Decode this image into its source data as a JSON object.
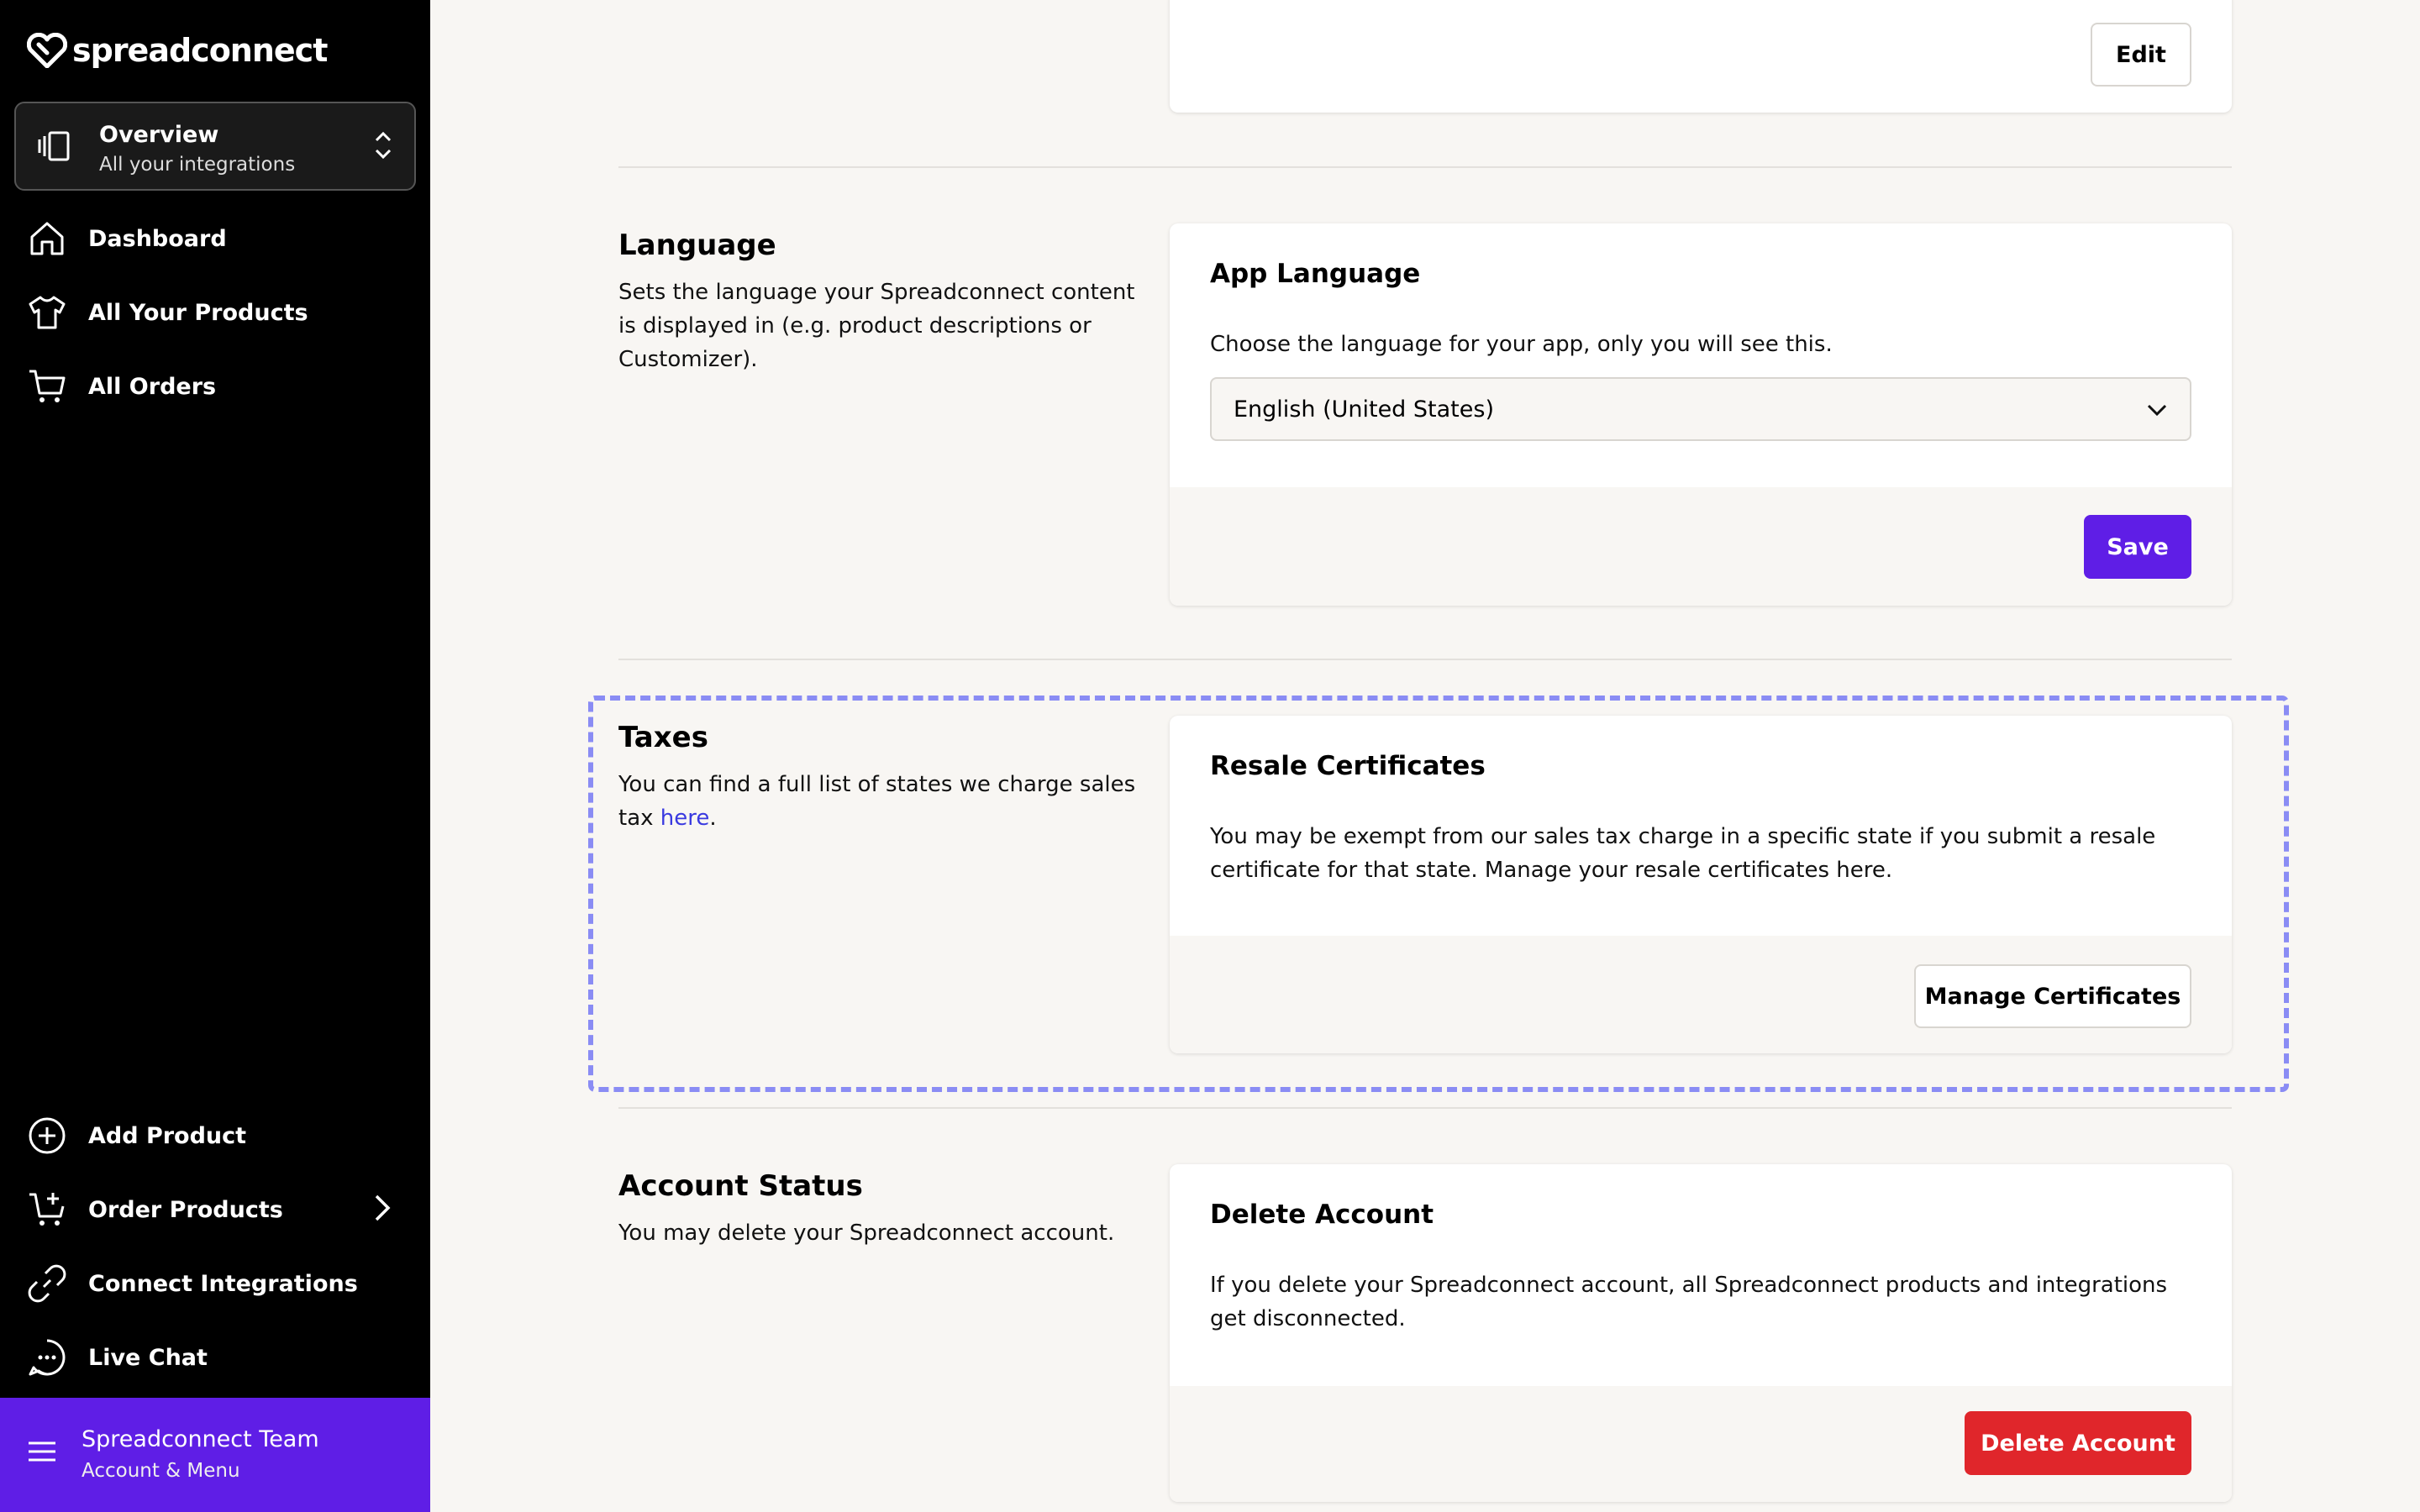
{
  "brand": {
    "name": "spreadconnect"
  },
  "switcher": {
    "title": "Overview",
    "subtitle": "All your integrations"
  },
  "nav": {
    "dashboard": "Dashboard",
    "products": "All Your Products",
    "orders": "All Orders",
    "add_product": "Add Product",
    "order_products": "Order Products",
    "connect": "Connect Integrations",
    "chat": "Live Chat"
  },
  "account": {
    "name": "Spreadconnect Team",
    "subtitle": "Account & Menu"
  },
  "top_card": {
    "edit_label": "Edit"
  },
  "language": {
    "title": "Language",
    "description": "Sets the language your Spreadconnect content is displayed in (e.g. product descriptions or Customizer).",
    "card_title": "App Language",
    "card_text": "Choose the language for your app, only you will see this.",
    "selected": "English (United States)",
    "save_label": "Save"
  },
  "taxes": {
    "title": "Taxes",
    "description_prefix": "You can find a full list of states we charge sales tax ",
    "link_text": "here",
    "description_suffix": ".",
    "card_title": "Resale Certificates",
    "card_text": "You may be exempt from our sales tax charge in a specific state if you submit a resale certificate for that state. Manage your resale certificates here.",
    "button_label": "Manage Certificates"
  },
  "account_status": {
    "title": "Account Status",
    "description": "You may delete your Spreadconnect account.",
    "card_title": "Delete Account",
    "card_text": "If you delete your Spreadconnect account, all Spreadconnect products and integrations get disconnected.",
    "button_label": "Delete Account"
  },
  "colors": {
    "accent": "#5f1ee6",
    "danger": "#e0262b",
    "highlight": "#8a8cf4"
  }
}
